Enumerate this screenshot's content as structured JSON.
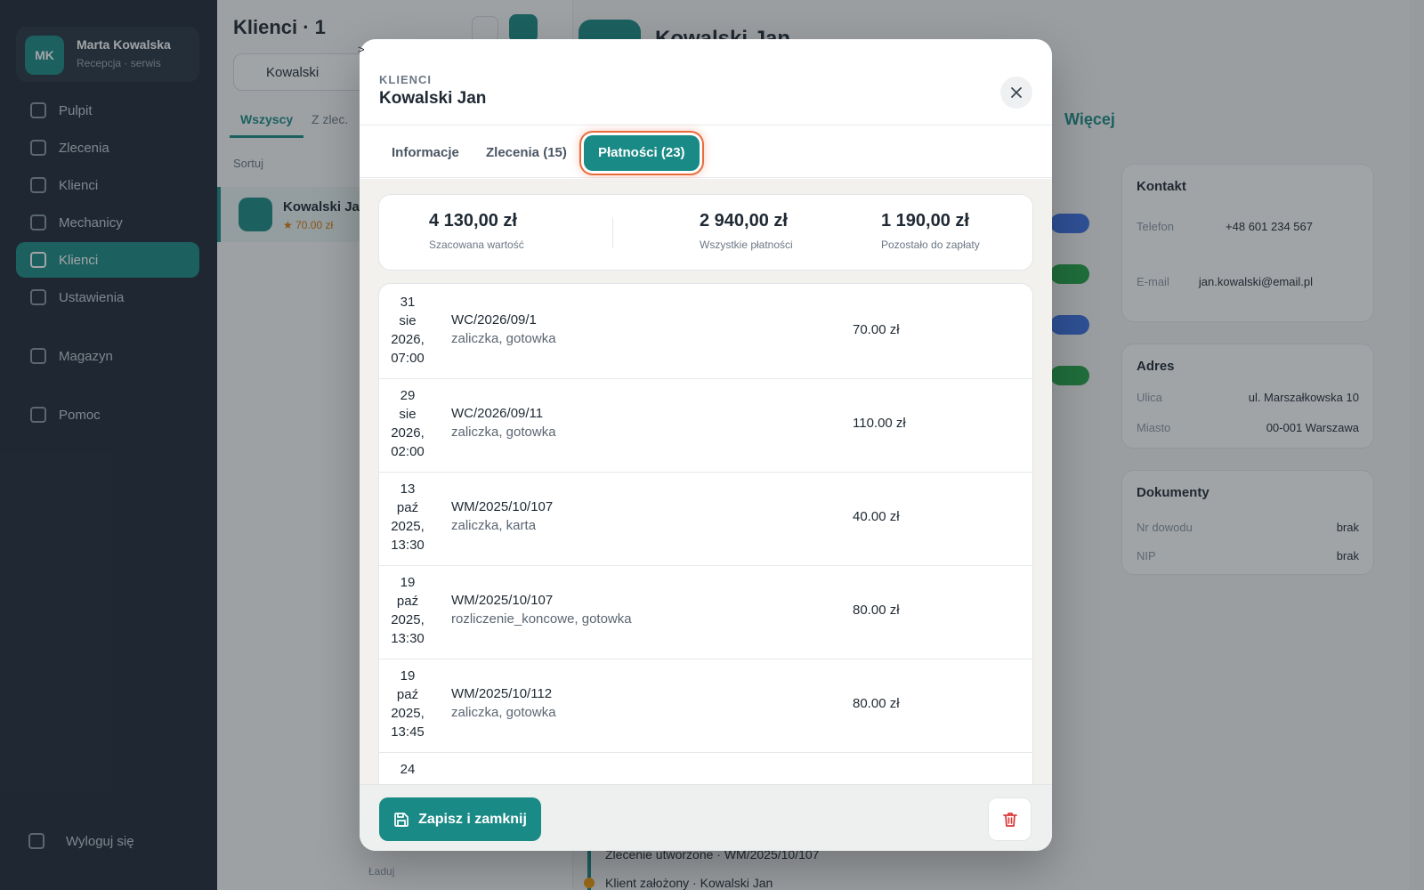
{
  "background": {
    "sidebar": {
      "user_initials": "MK",
      "user_name": "Marta Kowalska",
      "user_role": "Recepcja · serwis",
      "nav": [
        "Pulpit",
        "Zlecenia",
        "Klienci",
        "Mechanicy",
        "Klienci",
        "Ustawienia",
        "Magazyn",
        "Pomoc"
      ],
      "logout_label": "Wyloguj się"
    },
    "list": {
      "title": "Klienci · 1",
      "search_value": "Kowalski",
      "tab_active": "Wszyscy",
      "tab_other": "Z zlec.",
      "sort_label": "Sortuj",
      "row_name": "Kowalski Jan",
      "row_sub": "★ 70.00 zł",
      "footer": "Ładuj"
    },
    "detail": {
      "title": "Kowalski Jan",
      "link": "Więcej",
      "contact_header": "Kontakt",
      "phone_label": "Telefon",
      "phone_value": "+48 601 234 567",
      "email_label": "E-mail",
      "email_value": "jan.kowalski@email.pl",
      "address_header": "Adres",
      "street_label": "Ulica",
      "street_value": "ul. Marszałkowska 10",
      "city_label": "Miasto",
      "city_value": "00-001 Warszawa",
      "docs_header": "Dokumenty",
      "docs_nip_label": "Nr dowodu",
      "docs_nip_value": "brak",
      "docs_vat_label": "NIP",
      "docs_vat_value": "brak",
      "timeline_1": "Zlecenie utworzone · WM/2025/10/107",
      "timeline_2": "Klient założony · Kowalski Jan"
    }
  },
  "modal": {
    "kicker": "KLIENCI",
    "title": "Kowalski Jan",
    "close_icon": "close-icon",
    "tabs": [
      {
        "label": "Informacje",
        "active": false
      },
      {
        "label": "Zlecenia (15)",
        "active": false
      },
      {
        "label": "Płatności (23)",
        "active": true
      }
    ],
    "summary": {
      "estimated": {
        "value": "4 130,00 zł",
        "label": "Szacowana wartość"
      },
      "all_payments": {
        "value": "2 940,00 zł",
        "label": "Wszystkie płatności"
      },
      "remaining": {
        "value": "1 190,00 zł",
        "label": "Pozostało do zapłaty"
      }
    },
    "payments": [
      {
        "date": [
          "31",
          "sie",
          "2026,",
          "07:00"
        ],
        "number": "WC/2026/09/1",
        "meta": "zaliczka, gotowka",
        "amount": "70.00 zł"
      },
      {
        "date": [
          "29",
          "sie",
          "2026,",
          "02:00"
        ],
        "number": "WC/2026/09/11",
        "meta": "zaliczka, gotowka",
        "amount": "110.00 zł"
      },
      {
        "date": [
          "13",
          "paź",
          "2025,",
          "13:30"
        ],
        "number": "WM/2025/10/107",
        "meta": "zaliczka, karta",
        "amount": "40.00 zł"
      },
      {
        "date": [
          "19",
          "paź",
          "2025,",
          "13:30"
        ],
        "number": "WM/2025/10/107",
        "meta": "rozliczenie_koncowe, gotowka",
        "amount": "80.00 zł"
      },
      {
        "date": [
          "19",
          "paź",
          "2025,",
          "13:45"
        ],
        "number": "WM/2025/10/112",
        "meta": "zaliczka, gotowka",
        "amount": "80.00 zł"
      },
      {
        "date": [
          "24",
          "",
          "",
          ""
        ],
        "number": "",
        "meta": "",
        "amount": ""
      }
    ],
    "footer": {
      "save_label": "Zapisz i zamknij",
      "save_icon": "floppy-disk-icon",
      "delete_icon": "trash-icon"
    },
    "accent_color": "#1a8a86",
    "highlight_color": "#ea6a3c"
  }
}
